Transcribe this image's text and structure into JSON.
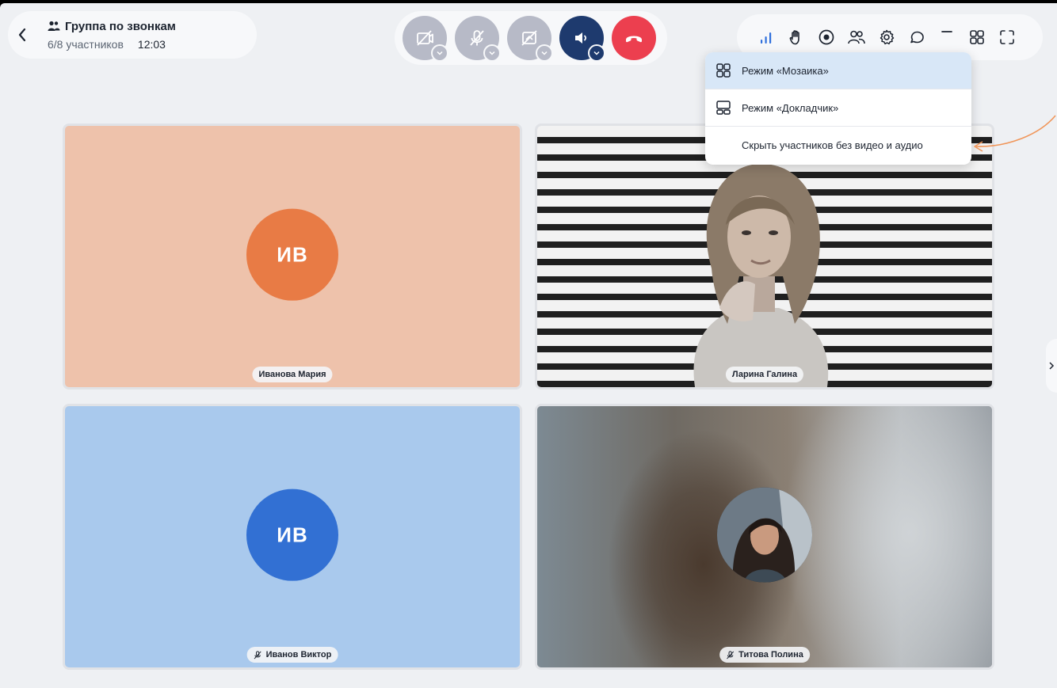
{
  "header": {
    "title": "Группа по звонкам",
    "participants": "6/8 участников",
    "time": "12:03"
  },
  "controls": [
    {
      "name": "camera-off",
      "icon": "camera-off-icon"
    },
    {
      "name": "microphone-off",
      "icon": "mic-off-icon"
    },
    {
      "name": "screen-share-off",
      "icon": "screen-share-off-icon"
    },
    {
      "name": "speaker",
      "icon": "speaker-icon"
    },
    {
      "name": "end-call",
      "icon": "phone-hangup-icon"
    }
  ],
  "toolbar": [
    "signal-icon",
    "raise-hand-icon",
    "record-icon",
    "participants-icon",
    "settings-icon",
    "chat-icon",
    "minimize-icon",
    "layout-grid-icon",
    "fullscreen-icon"
  ],
  "layout_menu": {
    "items": [
      {
        "label": "Режим «Мозаика»",
        "icon": "mosaic-icon",
        "active": true
      },
      {
        "label": "Режим «Докладчик»",
        "icon": "speaker-layout-icon",
        "active": false
      },
      {
        "label": "Скрыть участников без видео и аудио",
        "icon": "",
        "active": false
      }
    ]
  },
  "tiles": [
    {
      "initials": "ИВ",
      "name": "Иванова Мария",
      "muted": false,
      "color": "#e87b45",
      "bg": "#eec2ab"
    },
    {
      "initials": "",
      "name": "Ларина Галина",
      "muted": false
    },
    {
      "initials": "ИВ",
      "name": "Иванов Виктор",
      "muted": true,
      "color": "#3270d3",
      "bg": "#a9c9ed"
    },
    {
      "initials": "",
      "name": "Титова Полина",
      "muted": true
    }
  ],
  "colors": {
    "accent_red": "#ec3f4f",
    "navy": "#1e3a6e",
    "menu_active": "#d8e7f7",
    "icon_blue": "#2f6fdc"
  }
}
